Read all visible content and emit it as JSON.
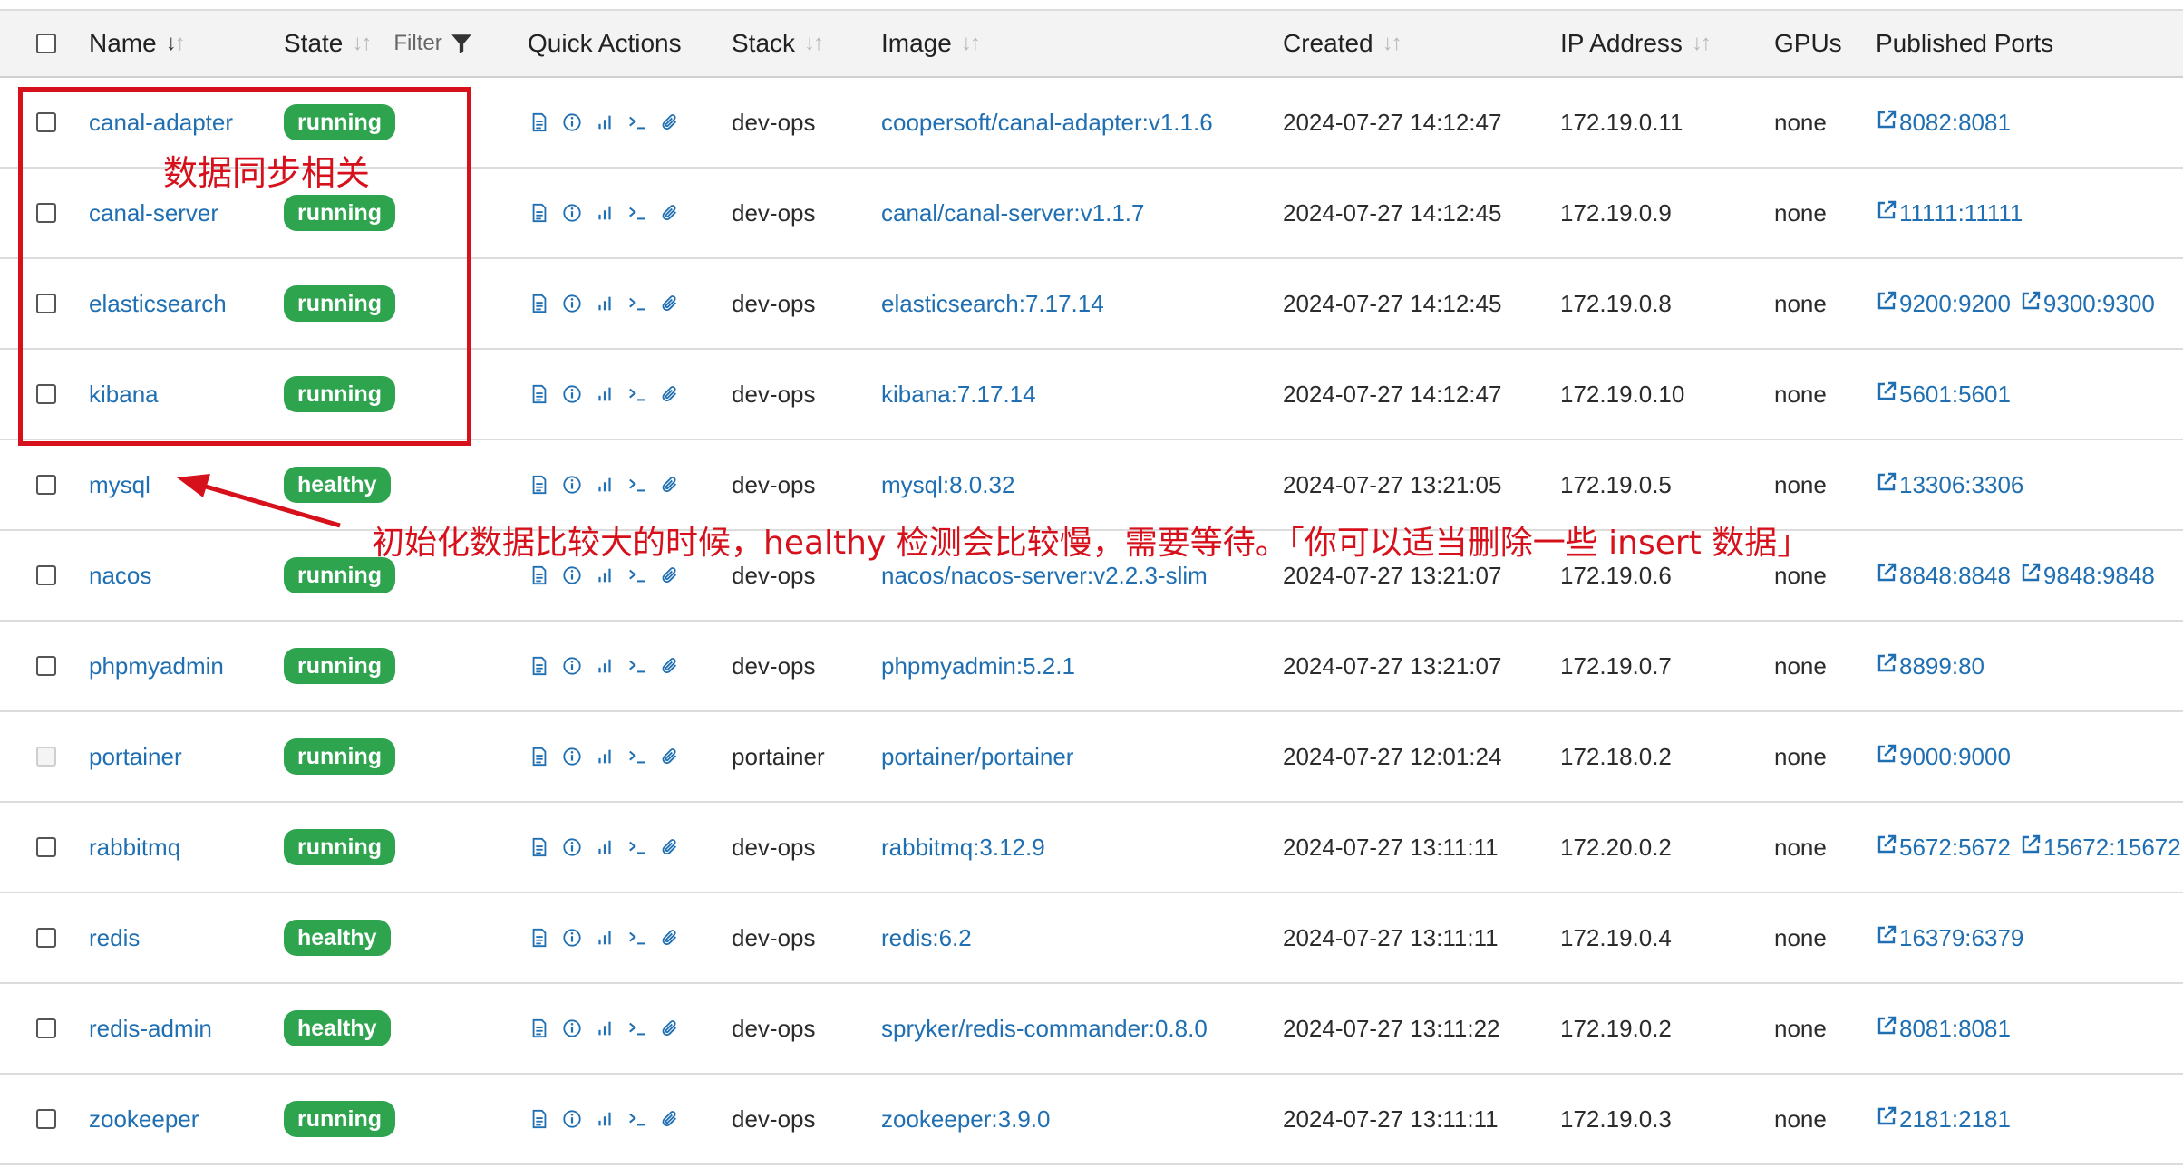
{
  "columns": {
    "name": "Name",
    "state": "State",
    "filter": "Filter",
    "quick_actions": "Quick Actions",
    "stack": "Stack",
    "image": "Image",
    "created": "Created",
    "ip": "IP Address",
    "gpus": "GPUs",
    "ports": "Published Ports"
  },
  "status_colors": {
    "running": "#2ea44f",
    "healthy": "#2ea44f"
  },
  "quick_action_icons": [
    "logs-icon",
    "inspect-icon",
    "stats-icon",
    "console-icon",
    "attach-icon"
  ],
  "containers": [
    {
      "name": "canal-adapter",
      "state": "running",
      "stack": "dev-ops",
      "image": "coopersoft/canal-adapter:v1.1.6",
      "created": "2024-07-27 14:12:47",
      "ip": "172.19.0.11",
      "gpus": "none",
      "ports": [
        "8082:8081"
      ]
    },
    {
      "name": "canal-server",
      "state": "running",
      "stack": "dev-ops",
      "image": "canal/canal-server:v1.1.7",
      "created": "2024-07-27 14:12:45",
      "ip": "172.19.0.9",
      "gpus": "none",
      "ports": [
        "11111:11111"
      ]
    },
    {
      "name": "elasticsearch",
      "state": "running",
      "stack": "dev-ops",
      "image": "elasticsearch:7.17.14",
      "created": "2024-07-27 14:12:45",
      "ip": "172.19.0.8",
      "gpus": "none",
      "ports": [
        "9200:9200",
        "9300:9300"
      ]
    },
    {
      "name": "kibana",
      "state": "running",
      "stack": "dev-ops",
      "image": "kibana:7.17.14",
      "created": "2024-07-27 14:12:47",
      "ip": "172.19.0.10",
      "gpus": "none",
      "ports": [
        "5601:5601"
      ]
    },
    {
      "name": "mysql",
      "state": "healthy",
      "stack": "dev-ops",
      "image": "mysql:8.0.32",
      "created": "2024-07-27 13:21:05",
      "ip": "172.19.0.5",
      "gpus": "none",
      "ports": [
        "13306:3306"
      ]
    },
    {
      "name": "nacos",
      "state": "running",
      "stack": "dev-ops",
      "image": "nacos/nacos-server:v2.2.3-slim",
      "created": "2024-07-27 13:21:07",
      "ip": "172.19.0.6",
      "gpus": "none",
      "ports": [
        "8848:8848",
        "9848:9848"
      ]
    },
    {
      "name": "phpmyadmin",
      "state": "running",
      "stack": "dev-ops",
      "image": "phpmyadmin:5.2.1",
      "created": "2024-07-27 13:21:07",
      "ip": "172.19.0.7",
      "gpus": "none",
      "ports": [
        "8899:80"
      ]
    },
    {
      "name": "portainer",
      "state": "running",
      "stack": "portainer",
      "image": "portainer/portainer",
      "created": "2024-07-27 12:01:24",
      "ip": "172.18.0.2",
      "gpus": "none",
      "ports": [
        "9000:9000"
      ],
      "checkbox_disabled": true
    },
    {
      "name": "rabbitmq",
      "state": "running",
      "stack": "dev-ops",
      "image": "rabbitmq:3.12.9",
      "created": "2024-07-27 13:11:11",
      "ip": "172.20.0.2",
      "gpus": "none",
      "ports": [
        "5672:5672",
        "15672:15672"
      ]
    },
    {
      "name": "redis",
      "state": "healthy",
      "stack": "dev-ops",
      "image": "redis:6.2",
      "created": "2024-07-27 13:11:11",
      "ip": "172.19.0.4",
      "gpus": "none",
      "ports": [
        "16379:6379"
      ]
    },
    {
      "name": "redis-admin",
      "state": "healthy",
      "stack": "dev-ops",
      "image": "spryker/redis-commander:0.8.0",
      "created": "2024-07-27 13:11:22",
      "ip": "172.19.0.2",
      "gpus": "none",
      "ports": [
        "8081:8081"
      ]
    },
    {
      "name": "zookeeper",
      "state": "running",
      "stack": "dev-ops",
      "image": "zookeeper:3.9.0",
      "created": "2024-07-27 13:11:11",
      "ip": "172.19.0.3",
      "gpus": "none",
      "ports": [
        "2181:2181"
      ]
    }
  ],
  "annotations": {
    "box_label": "数据同步相关",
    "arrow_note": "初始化数据比较大的时候，healthy 检测会比较慢，需要等待。「你可以适当删除一些 insert 数据」",
    "color": "#d6111c"
  }
}
